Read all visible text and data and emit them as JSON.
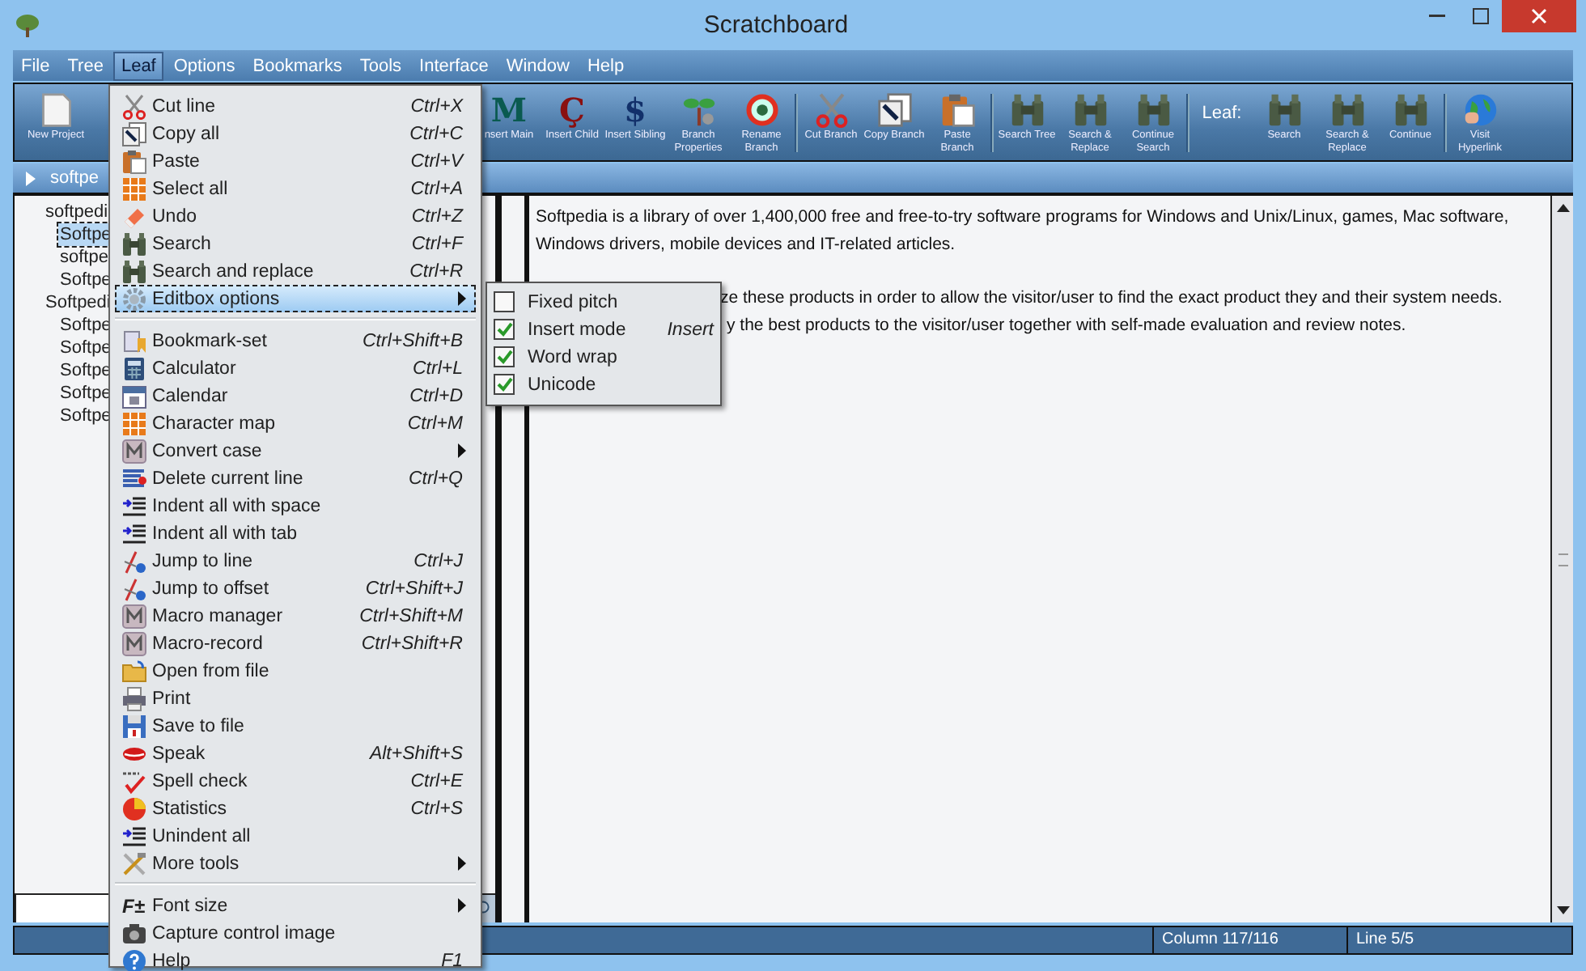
{
  "window": {
    "title": "Scratchboard"
  },
  "menubar": [
    {
      "label": "File",
      "selected": false
    },
    {
      "label": "Tree",
      "selected": false
    },
    {
      "label": "Leaf",
      "selected": true
    },
    {
      "label": "Options",
      "selected": false
    },
    {
      "label": "Bookmarks",
      "selected": false
    },
    {
      "label": "Tools",
      "selected": false
    },
    {
      "label": "Interface",
      "selected": false
    },
    {
      "label": "Window",
      "selected": false
    },
    {
      "label": "Help",
      "selected": false
    }
  ],
  "toolbar": {
    "items": [
      {
        "kind": "button",
        "label": "New Project"
      },
      {
        "kind": "gap"
      },
      {
        "kind": "button",
        "label": "nsert Main",
        "icon_text": "M"
      },
      {
        "kind": "button",
        "label": "Insert Child",
        "icon_text": "Ç"
      },
      {
        "kind": "button",
        "label": "Insert Sibling",
        "icon_text": "$"
      },
      {
        "kind": "button",
        "label": "Branch Properties"
      },
      {
        "kind": "button",
        "label": "Rename Branch"
      },
      {
        "kind": "separator"
      },
      {
        "kind": "button",
        "label": "Cut Branch"
      },
      {
        "kind": "button",
        "label": "Copy Branch"
      },
      {
        "kind": "button",
        "label": "Paste Branch"
      },
      {
        "kind": "separator"
      },
      {
        "kind": "button",
        "label": "Search Tree"
      },
      {
        "kind": "button",
        "label": "Search & Replace"
      },
      {
        "kind": "button",
        "label": "Continue Search"
      },
      {
        "kind": "separator"
      },
      {
        "kind": "label",
        "label": "Leaf:"
      },
      {
        "kind": "button",
        "label": "Search"
      },
      {
        "kind": "button",
        "label": "Search & Replace"
      },
      {
        "kind": "button",
        "label": "Continue"
      },
      {
        "kind": "separator"
      },
      {
        "kind": "button",
        "label": "Visit Hyperlink"
      }
    ]
  },
  "breadcrumb": {
    "text": "softpe"
  },
  "tree": [
    {
      "label": "softpedi",
      "selected": false,
      "children": [
        {
          "label": "Softpe",
          "selected": true
        },
        {
          "label": "softpe",
          "selected": false
        },
        {
          "label": "Softpe",
          "selected": false
        }
      ]
    },
    {
      "label": "Softpedi",
      "selected": false,
      "children": [
        {
          "label": "Softpe",
          "selected": false
        },
        {
          "label": "Softpe",
          "selected": false
        },
        {
          "label": "Softpe",
          "selected": false
        },
        {
          "label": "Softpe",
          "selected": false
        },
        {
          "label": "Softpe",
          "selected": false
        }
      ]
    }
  ],
  "editor": {
    "paragraphs": [
      [
        "Softpedia is a library of over 1,400,000 free and free-to-try software programs for Windows and Unix/Linux, games, Mac software,",
        "Windows drivers, mobile devices and IT-related articles."
      ],
      [
        "ze these products in order to allow the visitor/user to find the exact product they and their system needs.",
        "y the best products to the visitor/user together with self-made evaluation and review notes."
      ]
    ]
  },
  "leaf_menu": [
    {
      "kind": "item",
      "label": "Cut line",
      "shortcut": "Ctrl+X",
      "submenu": false,
      "selected": false
    },
    {
      "kind": "item",
      "label": "Copy all",
      "shortcut": "Ctrl+C",
      "submenu": false,
      "selected": false
    },
    {
      "kind": "item",
      "label": "Paste",
      "shortcut": "Ctrl+V",
      "submenu": false,
      "selected": false
    },
    {
      "kind": "item",
      "label": "Select all",
      "shortcut": "Ctrl+A",
      "submenu": false,
      "selected": false
    },
    {
      "kind": "item",
      "label": "Undo",
      "shortcut": "Ctrl+Z",
      "submenu": false,
      "selected": false
    },
    {
      "kind": "item",
      "label": "Search",
      "shortcut": "Ctrl+F",
      "submenu": false,
      "selected": false
    },
    {
      "kind": "item",
      "label": "Search and replace",
      "shortcut": "Ctrl+R",
      "submenu": false,
      "selected": false
    },
    {
      "kind": "item",
      "label": "Editbox options",
      "submenu": true,
      "selected": true
    },
    {
      "kind": "separator"
    },
    {
      "kind": "item",
      "label": "Bookmark-set",
      "shortcut": "Ctrl+Shift+B",
      "submenu": false,
      "selected": false
    },
    {
      "kind": "item",
      "label": "Calculator",
      "shortcut": "Ctrl+L",
      "submenu": false,
      "selected": false
    },
    {
      "kind": "item",
      "label": "Calendar",
      "shortcut": "Ctrl+D",
      "submenu": false,
      "selected": false
    },
    {
      "kind": "item",
      "label": "Character map",
      "shortcut": "Ctrl+M",
      "submenu": false,
      "selected": false
    },
    {
      "kind": "item",
      "label": "Convert case",
      "submenu": true,
      "selected": false
    },
    {
      "kind": "item",
      "label": "Delete current line",
      "shortcut": "Ctrl+Q",
      "submenu": false,
      "selected": false
    },
    {
      "kind": "item",
      "label": "Indent all with space",
      "submenu": false,
      "selected": false
    },
    {
      "kind": "item",
      "label": "Indent all with tab",
      "submenu": false,
      "selected": false
    },
    {
      "kind": "item",
      "label": "Jump to line",
      "shortcut": "Ctrl+J",
      "submenu": false,
      "selected": false
    },
    {
      "kind": "item",
      "label": "Jump to offset",
      "shortcut": "Ctrl+Shift+J",
      "submenu": false,
      "selected": false
    },
    {
      "kind": "item",
      "label": "Macro manager",
      "shortcut": "Ctrl+Shift+M",
      "submenu": false,
      "selected": false
    },
    {
      "kind": "item",
      "label": "Macro-record",
      "shortcut": "Ctrl+Shift+R",
      "submenu": false,
      "selected": false
    },
    {
      "kind": "item",
      "label": "Open from file",
      "submenu": false,
      "selected": false
    },
    {
      "kind": "item",
      "label": "Print",
      "submenu": false,
      "selected": false
    },
    {
      "kind": "item",
      "label": "Save to file",
      "submenu": false,
      "selected": false
    },
    {
      "kind": "item",
      "label": "Speak",
      "shortcut": "Alt+Shift+S",
      "submenu": false,
      "selected": false
    },
    {
      "kind": "item",
      "label": "Spell check",
      "shortcut": "Ctrl+E",
      "submenu": false,
      "selected": false
    },
    {
      "kind": "item",
      "label": "Statistics",
      "shortcut": "Ctrl+S",
      "submenu": false,
      "selected": false
    },
    {
      "kind": "item",
      "label": "Unindent all",
      "submenu": false,
      "selected": false
    },
    {
      "kind": "item",
      "label": "More tools",
      "submenu": true,
      "selected": false
    },
    {
      "kind": "separator"
    },
    {
      "kind": "item",
      "label": "Font size",
      "icon_text": "F±",
      "submenu": true,
      "selected": false
    },
    {
      "kind": "item",
      "label": "Capture control image",
      "submenu": false,
      "selected": false
    },
    {
      "kind": "item",
      "label": "Help",
      "shortcut": "F1",
      "submenu": false,
      "selected": false
    }
  ],
  "editbox_submenu": [
    {
      "label": "Fixed pitch",
      "checked": false
    },
    {
      "label": "Insert mode",
      "checked": true,
      "shortcut": "Insert"
    },
    {
      "label": "Word wrap",
      "checked": true
    },
    {
      "label": "Unicode",
      "checked": true
    }
  ],
  "status_bar": {
    "column": "Column 117/116",
    "line": "Line 5/5"
  }
}
